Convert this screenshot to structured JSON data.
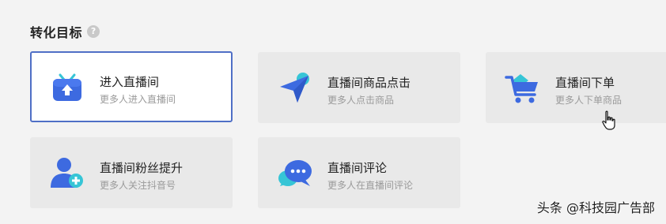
{
  "section": {
    "title": "转化目标",
    "help_icon": "question-icon"
  },
  "cards": [
    {
      "title": "进入直播间",
      "desc": "更多人进入直播间",
      "icon": "tv-enter-icon",
      "selected": true
    },
    {
      "title": "直播间商品点击",
      "desc": "更多人点击商品",
      "icon": "click-arrow-icon",
      "selected": false
    },
    {
      "title": "直播间下单",
      "desc": "更多人下单商品",
      "icon": "shopping-cart-icon",
      "selected": false
    },
    {
      "title": "直播间粉丝提升",
      "desc": "更多人关注抖音号",
      "icon": "add-user-icon",
      "selected": false
    },
    {
      "title": "直播间评论",
      "desc": "更多人在直播间评论",
      "icon": "chat-bubble-icon",
      "selected": false
    }
  ],
  "colors": {
    "accent_blue": "#3d6ae0",
    "accent_teal": "#36c5d6",
    "selected_border": "#4f6fc6"
  },
  "watermark": "头条 @科技园广告部"
}
